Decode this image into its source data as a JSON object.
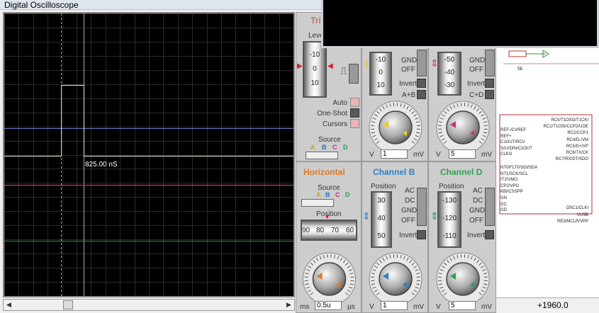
{
  "window": {
    "title": "Digital Oscilloscope"
  },
  "screen": {
    "cursor_readout": "825.00 nS",
    "traces": [
      {
        "name": "A",
        "color": "#e8e8c0"
      },
      {
        "name": "B",
        "color": "#6a7fd0"
      },
      {
        "name": "C",
        "color": "#d05060"
      },
      {
        "name": "D",
        "color": "#3c8a3c"
      }
    ]
  },
  "trigger": {
    "heading": "Trigger",
    "level_label": "Level",
    "level_ticks": [
      "-10",
      "0",
      "10"
    ],
    "auto_label": "Auto",
    "oneshot_label": "One-Shot",
    "cursors_label": "Cursors",
    "source_label": "Source",
    "source_channels": [
      "A",
      "B",
      "C",
      "D"
    ]
  },
  "horizontal": {
    "heading": "Horizontal",
    "source_label": "Source",
    "source_channels": [
      "A",
      "B",
      "C",
      "D"
    ],
    "position_label": "Position",
    "position_ticks": [
      "90",
      "80",
      "70",
      "60"
    ],
    "knob_unit_left": "ms",
    "knob_unit_right": "µs",
    "knob_value": "0.5u",
    "knob_scale": [
      "0.5",
      "0.2",
      "0.1",
      "1",
      "2",
      "5",
      "10",
      "20",
      "50",
      "100",
      "200"
    ]
  },
  "channel_a": {
    "position_ticks": [
      "-10",
      "0",
      "10"
    ],
    "coupling": [
      "GND",
      "OFF"
    ],
    "invert_label": "Invert",
    "combine_label": "A+B",
    "unit_left": "V",
    "unit_right": "mV",
    "volts_value": "1",
    "knob_scale": [
      "0.5",
      "1",
      "2",
      "5",
      "10",
      "20",
      "50",
      "0.2",
      "0.1",
      "20",
      "10",
      "5",
      "2",
      "1"
    ]
  },
  "channel_b": {
    "heading": "Channel B",
    "position_label": "Position",
    "position_ticks": [
      "30",
      "40",
      "50"
    ],
    "coupling": [
      "AC",
      "DC",
      "GND",
      "OFF"
    ],
    "invert_label": "Invert",
    "unit_left": "V",
    "unit_right": "mV",
    "volts_value": "1"
  },
  "channel_c": {
    "position_ticks": [
      "-50",
      "-40",
      "-30"
    ],
    "coupling": [
      "GND",
      "OFF"
    ],
    "invert_label": "Invert",
    "combine_label": "C+D",
    "unit_left": "V",
    "unit_right": "mV",
    "volts_value": "5"
  },
  "channel_d": {
    "heading": "Channel D",
    "position_label": "Position",
    "position_ticks": [
      "-130",
      "-120",
      "-110"
    ],
    "coupling": [
      "AC",
      "DC",
      "GND",
      "OFF"
    ],
    "invert_label": "Invert",
    "unit_left": "V",
    "unit_right": "mV",
    "volts_value": "5"
  },
  "schematic": {
    "resistor_value": "5k",
    "pins_right": [
      "RC0/T1OSO/T1CKI",
      "RC1/T1OSI/CCP2/UOE",
      "RC2/CCP1",
      "RC4/D-/VM",
      "RC5/D+/VP",
      "RC6/TX/CK",
      "RC7/RX/DT/SDO",
      "OSC1/CLKI",
      "VUSB",
      "RE3/MCLR/VPP"
    ],
    "pins_left": [
      "REF-/CVREF",
      "REF+",
      "C1OUT/RCV",
      "S/LVDIN/C2OUT",
      "CLKO",
      "NT0/FLT0/SDI/SDA",
      "NT1/SCK/SCL",
      "IT2/VMO",
      "CP2/VPO",
      "KBI/CSSPP",
      "GN",
      "GC",
      "GD"
    ],
    "status_value": "+1960.0"
  }
}
